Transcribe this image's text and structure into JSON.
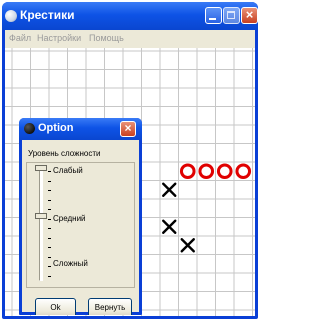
{
  "window": {
    "title": "Крестики"
  },
  "menu": {
    "items": [
      "Файл",
      "Настройки",
      "Помощь"
    ]
  },
  "dialog": {
    "title": "Option",
    "level_label": "Уровень сложности",
    "levels": [
      "Слабый",
      "Средний",
      "Сложный"
    ],
    "ok_label": "Ok",
    "reset_label": "Вернуть"
  },
  "board": {
    "x_marks": [
      [
        8,
        7
      ],
      [
        8,
        9
      ],
      [
        9,
        10
      ]
    ],
    "o_marks": [
      [
        9,
        6
      ],
      [
        10,
        6
      ],
      [
        11,
        6
      ],
      [
        12,
        6
      ]
    ]
  },
  "colors": {
    "title_bar": "#0a46d0",
    "grid_line": "#c7c7c7",
    "o_mark": "#e00000",
    "x_mark": "#000000"
  }
}
